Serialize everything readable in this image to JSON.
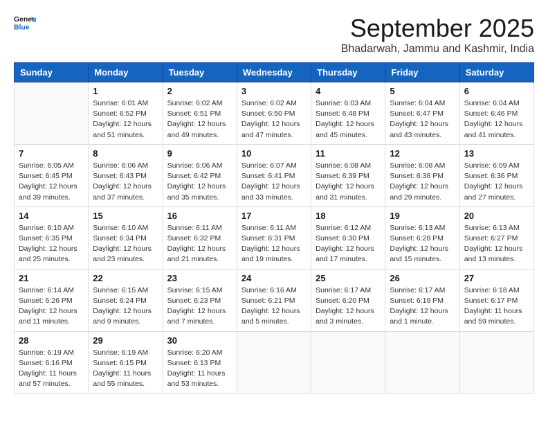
{
  "logo": {
    "line1": "General",
    "line2": "Blue"
  },
  "title": "September 2025",
  "location": "Bhadarwah, Jammu and Kashmir, India",
  "days_of_week": [
    "Sunday",
    "Monday",
    "Tuesday",
    "Wednesday",
    "Thursday",
    "Friday",
    "Saturday"
  ],
  "weeks": [
    [
      {
        "day": "",
        "info": ""
      },
      {
        "day": "1",
        "info": "Sunrise: 6:01 AM\nSunset: 6:52 PM\nDaylight: 12 hours\nand 51 minutes."
      },
      {
        "day": "2",
        "info": "Sunrise: 6:02 AM\nSunset: 6:51 PM\nDaylight: 12 hours\nand 49 minutes."
      },
      {
        "day": "3",
        "info": "Sunrise: 6:02 AM\nSunset: 6:50 PM\nDaylight: 12 hours\nand 47 minutes."
      },
      {
        "day": "4",
        "info": "Sunrise: 6:03 AM\nSunset: 6:48 PM\nDaylight: 12 hours\nand 45 minutes."
      },
      {
        "day": "5",
        "info": "Sunrise: 6:04 AM\nSunset: 6:47 PM\nDaylight: 12 hours\nand 43 minutes."
      },
      {
        "day": "6",
        "info": "Sunrise: 6:04 AM\nSunset: 6:46 PM\nDaylight: 12 hours\nand 41 minutes."
      }
    ],
    [
      {
        "day": "7",
        "info": "Sunrise: 6:05 AM\nSunset: 6:45 PM\nDaylight: 12 hours\nand 39 minutes."
      },
      {
        "day": "8",
        "info": "Sunrise: 6:06 AM\nSunset: 6:43 PM\nDaylight: 12 hours\nand 37 minutes."
      },
      {
        "day": "9",
        "info": "Sunrise: 6:06 AM\nSunset: 6:42 PM\nDaylight: 12 hours\nand 35 minutes."
      },
      {
        "day": "10",
        "info": "Sunrise: 6:07 AM\nSunset: 6:41 PM\nDaylight: 12 hours\nand 33 minutes."
      },
      {
        "day": "11",
        "info": "Sunrise: 6:08 AM\nSunset: 6:39 PM\nDaylight: 12 hours\nand 31 minutes."
      },
      {
        "day": "12",
        "info": "Sunrise: 6:08 AM\nSunset: 6:38 PM\nDaylight: 12 hours\nand 29 minutes."
      },
      {
        "day": "13",
        "info": "Sunrise: 6:09 AM\nSunset: 6:36 PM\nDaylight: 12 hours\nand 27 minutes."
      }
    ],
    [
      {
        "day": "14",
        "info": "Sunrise: 6:10 AM\nSunset: 6:35 PM\nDaylight: 12 hours\nand 25 minutes."
      },
      {
        "day": "15",
        "info": "Sunrise: 6:10 AM\nSunset: 6:34 PM\nDaylight: 12 hours\nand 23 minutes."
      },
      {
        "day": "16",
        "info": "Sunrise: 6:11 AM\nSunset: 6:32 PM\nDaylight: 12 hours\nand 21 minutes."
      },
      {
        "day": "17",
        "info": "Sunrise: 6:11 AM\nSunset: 6:31 PM\nDaylight: 12 hours\nand 19 minutes."
      },
      {
        "day": "18",
        "info": "Sunrise: 6:12 AM\nSunset: 6:30 PM\nDaylight: 12 hours\nand 17 minutes."
      },
      {
        "day": "19",
        "info": "Sunrise: 6:13 AM\nSunset: 6:28 PM\nDaylight: 12 hours\nand 15 minutes."
      },
      {
        "day": "20",
        "info": "Sunrise: 6:13 AM\nSunset: 6:27 PM\nDaylight: 12 hours\nand 13 minutes."
      }
    ],
    [
      {
        "day": "21",
        "info": "Sunrise: 6:14 AM\nSunset: 6:26 PM\nDaylight: 12 hours\nand 11 minutes."
      },
      {
        "day": "22",
        "info": "Sunrise: 6:15 AM\nSunset: 6:24 PM\nDaylight: 12 hours\nand 9 minutes."
      },
      {
        "day": "23",
        "info": "Sunrise: 6:15 AM\nSunset: 6:23 PM\nDaylight: 12 hours\nand 7 minutes."
      },
      {
        "day": "24",
        "info": "Sunrise: 6:16 AM\nSunset: 6:21 PM\nDaylight: 12 hours\nand 5 minutes."
      },
      {
        "day": "25",
        "info": "Sunrise: 6:17 AM\nSunset: 6:20 PM\nDaylight: 12 hours\nand 3 minutes."
      },
      {
        "day": "26",
        "info": "Sunrise: 6:17 AM\nSunset: 6:19 PM\nDaylight: 12 hours\nand 1 minute."
      },
      {
        "day": "27",
        "info": "Sunrise: 6:18 AM\nSunset: 6:17 PM\nDaylight: 11 hours\nand 59 minutes."
      }
    ],
    [
      {
        "day": "28",
        "info": "Sunrise: 6:19 AM\nSunset: 6:16 PM\nDaylight: 11 hours\nand 57 minutes."
      },
      {
        "day": "29",
        "info": "Sunrise: 6:19 AM\nSunset: 6:15 PM\nDaylight: 11 hours\nand 55 minutes."
      },
      {
        "day": "30",
        "info": "Sunrise: 6:20 AM\nSunset: 6:13 PM\nDaylight: 11 hours\nand 53 minutes."
      },
      {
        "day": "",
        "info": ""
      },
      {
        "day": "",
        "info": ""
      },
      {
        "day": "",
        "info": ""
      },
      {
        "day": "",
        "info": ""
      }
    ]
  ]
}
